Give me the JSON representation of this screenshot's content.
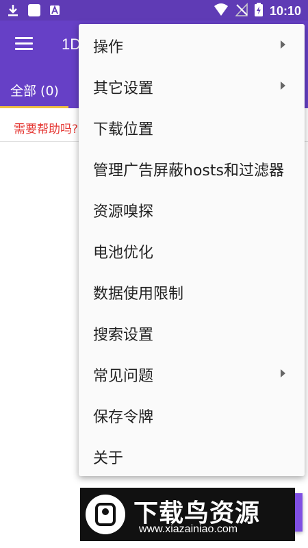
{
  "status_bar": {
    "time": "10:10",
    "icons": [
      "download-icon",
      "square-icon",
      "a-icon",
      "wifi-icon",
      "no-signal-icon",
      "battery-charging-icon"
    ]
  },
  "app_bar": {
    "title": "1D",
    "menu_icon": "hamburger-icon"
  },
  "tabs": [
    {
      "label": "全部 (0)"
    }
  ],
  "help_text": "需要帮助吗?",
  "overflow_menu": {
    "items": [
      {
        "label": "操作",
        "has_submenu": true
      },
      {
        "label": "其它设置",
        "has_submenu": true
      },
      {
        "label": "下载位置",
        "has_submenu": false
      },
      {
        "label": "管理广告屏蔽hosts和过滤器",
        "has_submenu": false
      },
      {
        "label": "资源嗅探",
        "has_submenu": false
      },
      {
        "label": "电池优化",
        "has_submenu": false
      },
      {
        "label": "数据使用限制",
        "has_submenu": false
      },
      {
        "label": "搜索设置",
        "has_submenu": false
      },
      {
        "label": "常见问题",
        "has_submenu": true
      },
      {
        "label": "保存令牌",
        "has_submenu": false
      },
      {
        "label": "关于",
        "has_submenu": false
      }
    ]
  },
  "watermark": {
    "title": "下载鸟资源",
    "url": "www.xiazainiao.com"
  },
  "colors": {
    "primary": "#6640c6",
    "status_bar": "#5f3bb5",
    "accent": "#f0c040",
    "help_text": "#e53935"
  }
}
